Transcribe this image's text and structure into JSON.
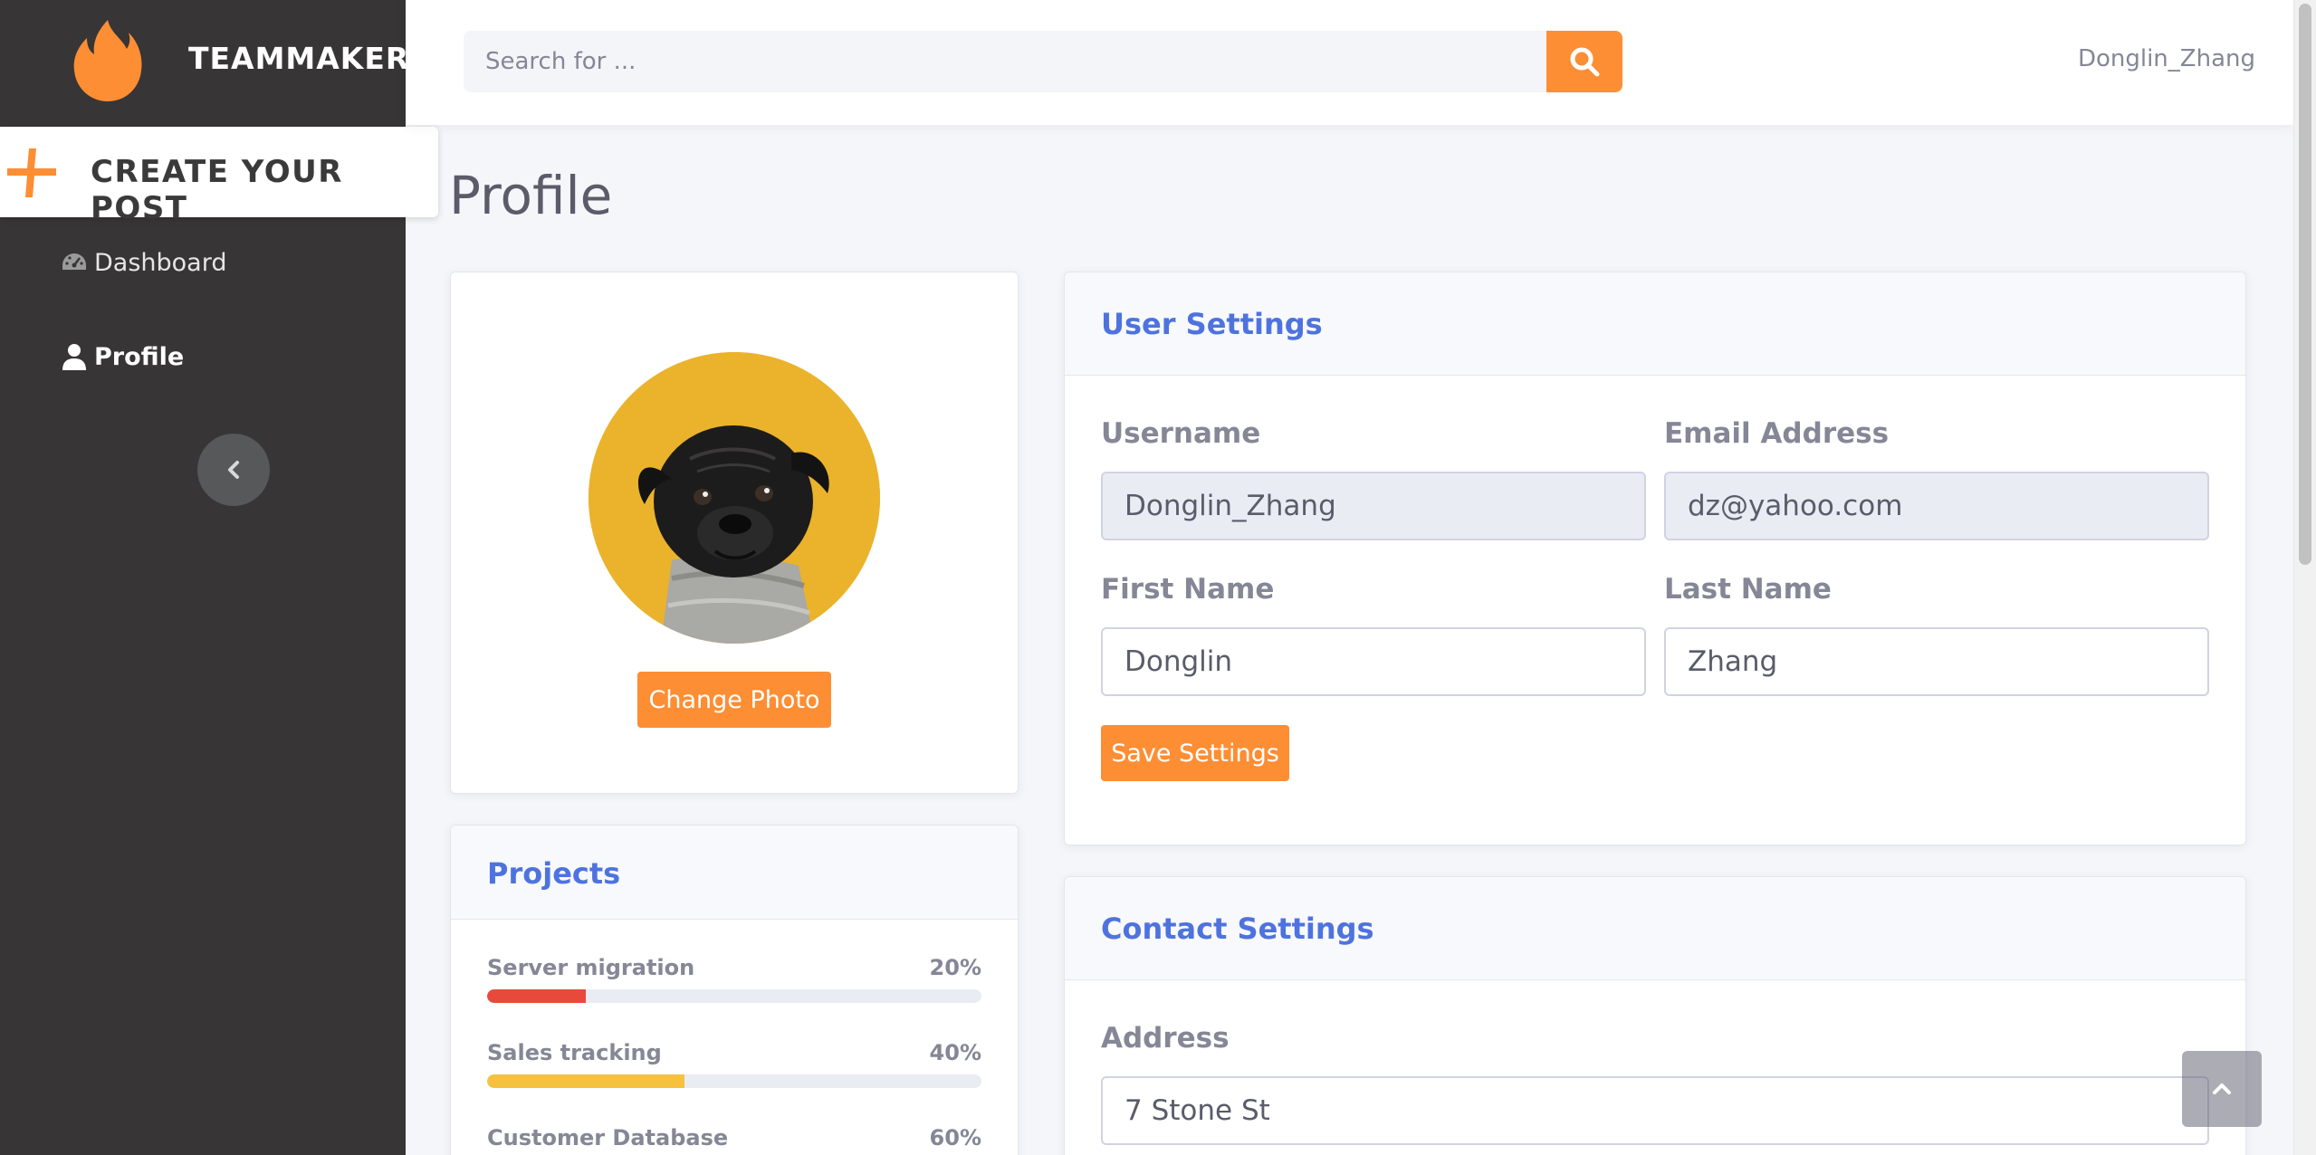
{
  "brand": {
    "name": "TEAMMAKER",
    "icon": "flame-icon",
    "accent": "#fd8e34"
  },
  "sidebar": {
    "create_post": "CREATE YOUR POST",
    "items": [
      {
        "label": "Dashboard",
        "icon": "dashboard-icon"
      },
      {
        "label": "Profile",
        "icon": "user-icon",
        "active": true
      }
    ],
    "collapse_icon": "chevron-left-icon"
  },
  "topbar": {
    "search_placeholder": "Search for ...",
    "search_icon": "search-icon",
    "user": "Donglin_Zhang"
  },
  "page": {
    "title": "Profile"
  },
  "photo_card": {
    "button": "Change Photo"
  },
  "projects": {
    "title": "Projects",
    "items": [
      {
        "name": "Server migration",
        "percent_label": "20%",
        "value": 20,
        "color": "#e74a3b"
      },
      {
        "name": "Sales tracking",
        "percent_label": "40%",
        "value": 40,
        "color": "#f6c23e"
      },
      {
        "name": "Customer Database",
        "percent_label": "60%",
        "value": 60,
        "color": "#4e73df"
      }
    ]
  },
  "user_settings": {
    "title": "User Settings",
    "username_label": "Username",
    "username_value": "Donglin_Zhang",
    "email_label": "Email Address",
    "email_value": "dz@yahoo.com",
    "first_name_label": "First Name",
    "first_name_value": "Donglin",
    "last_name_label": "Last Name",
    "last_name_value": "Zhang",
    "save_button": "Save Settings"
  },
  "contact_settings": {
    "title": "Contact Settings",
    "address_label": "Address",
    "address_value": "7 Stone St"
  },
  "scroll_top_icon": "chevron-up-icon"
}
